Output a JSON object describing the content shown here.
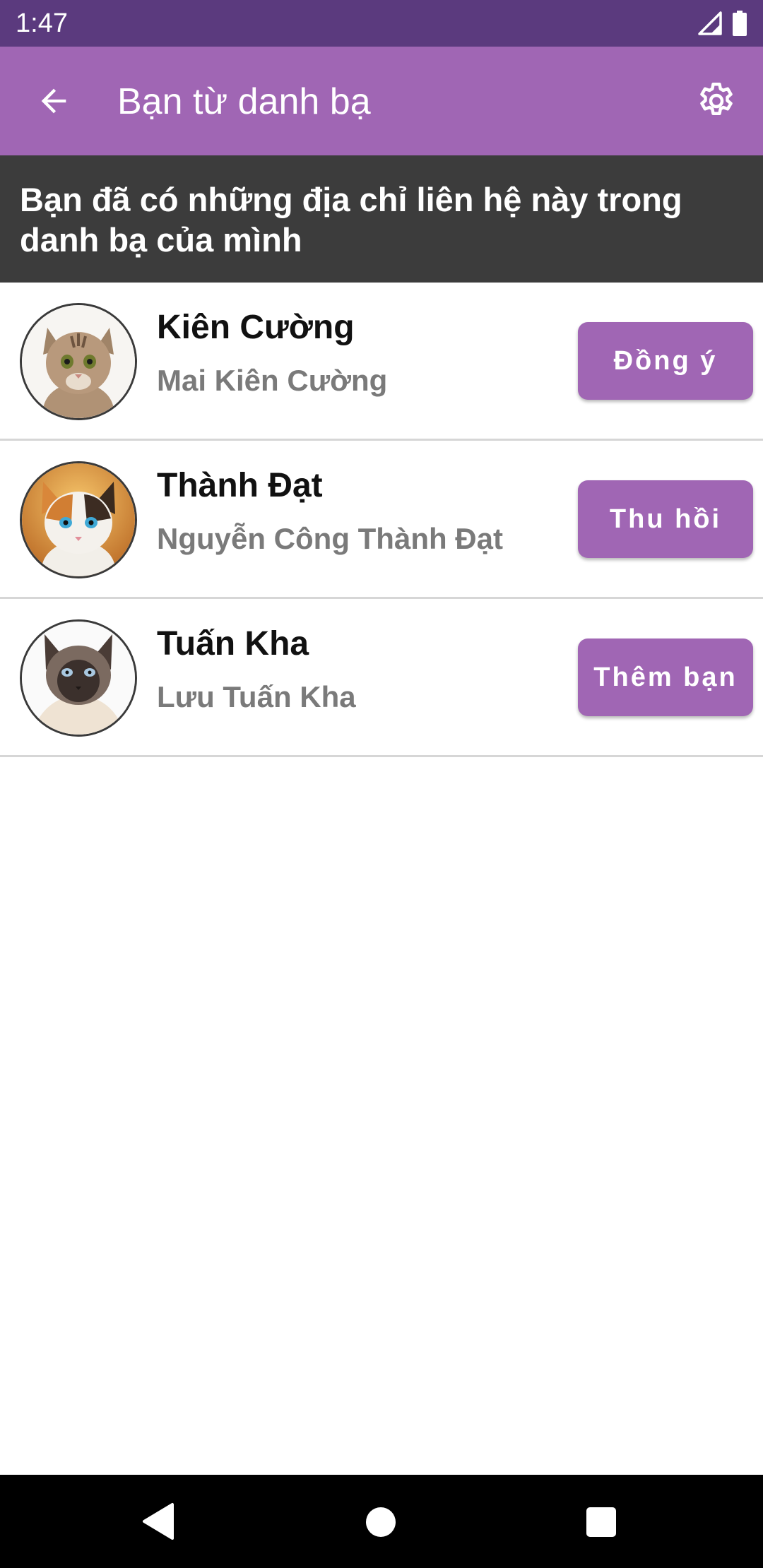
{
  "status_bar": {
    "time": "1:47",
    "icons": [
      "signal-icon",
      "battery-icon"
    ],
    "background": "#5b3a7e"
  },
  "app_bar": {
    "title": "Bạn từ danh bạ",
    "back_icon": "arrow-back-icon",
    "settings_icon": "gear-icon",
    "background": "#a066b4"
  },
  "banner": {
    "text": "Bạn đã có những địa chỉ liên hệ này trong danh bạ của mình",
    "background": "#3c3c3c"
  },
  "contacts": [
    {
      "name": "Kiên Cường",
      "full_name": "Mai Kiên Cường",
      "action": "Đồng ý",
      "avatar": "tabby-cat-avatar"
    },
    {
      "name": "Thành Đạt",
      "full_name": "Nguyễn Công Thành Đạt",
      "action": "Thu hồi",
      "avatar": "calico-cat-avatar"
    },
    {
      "name": "Tuấn Kha",
      "full_name": "Lưu Tuấn Kha",
      "action": "Thêm bạn",
      "avatar": "siamese-cat-avatar"
    }
  ],
  "nav_bar": {
    "icons": [
      "nav-back-icon",
      "nav-home-icon",
      "nav-recents-icon"
    ]
  }
}
